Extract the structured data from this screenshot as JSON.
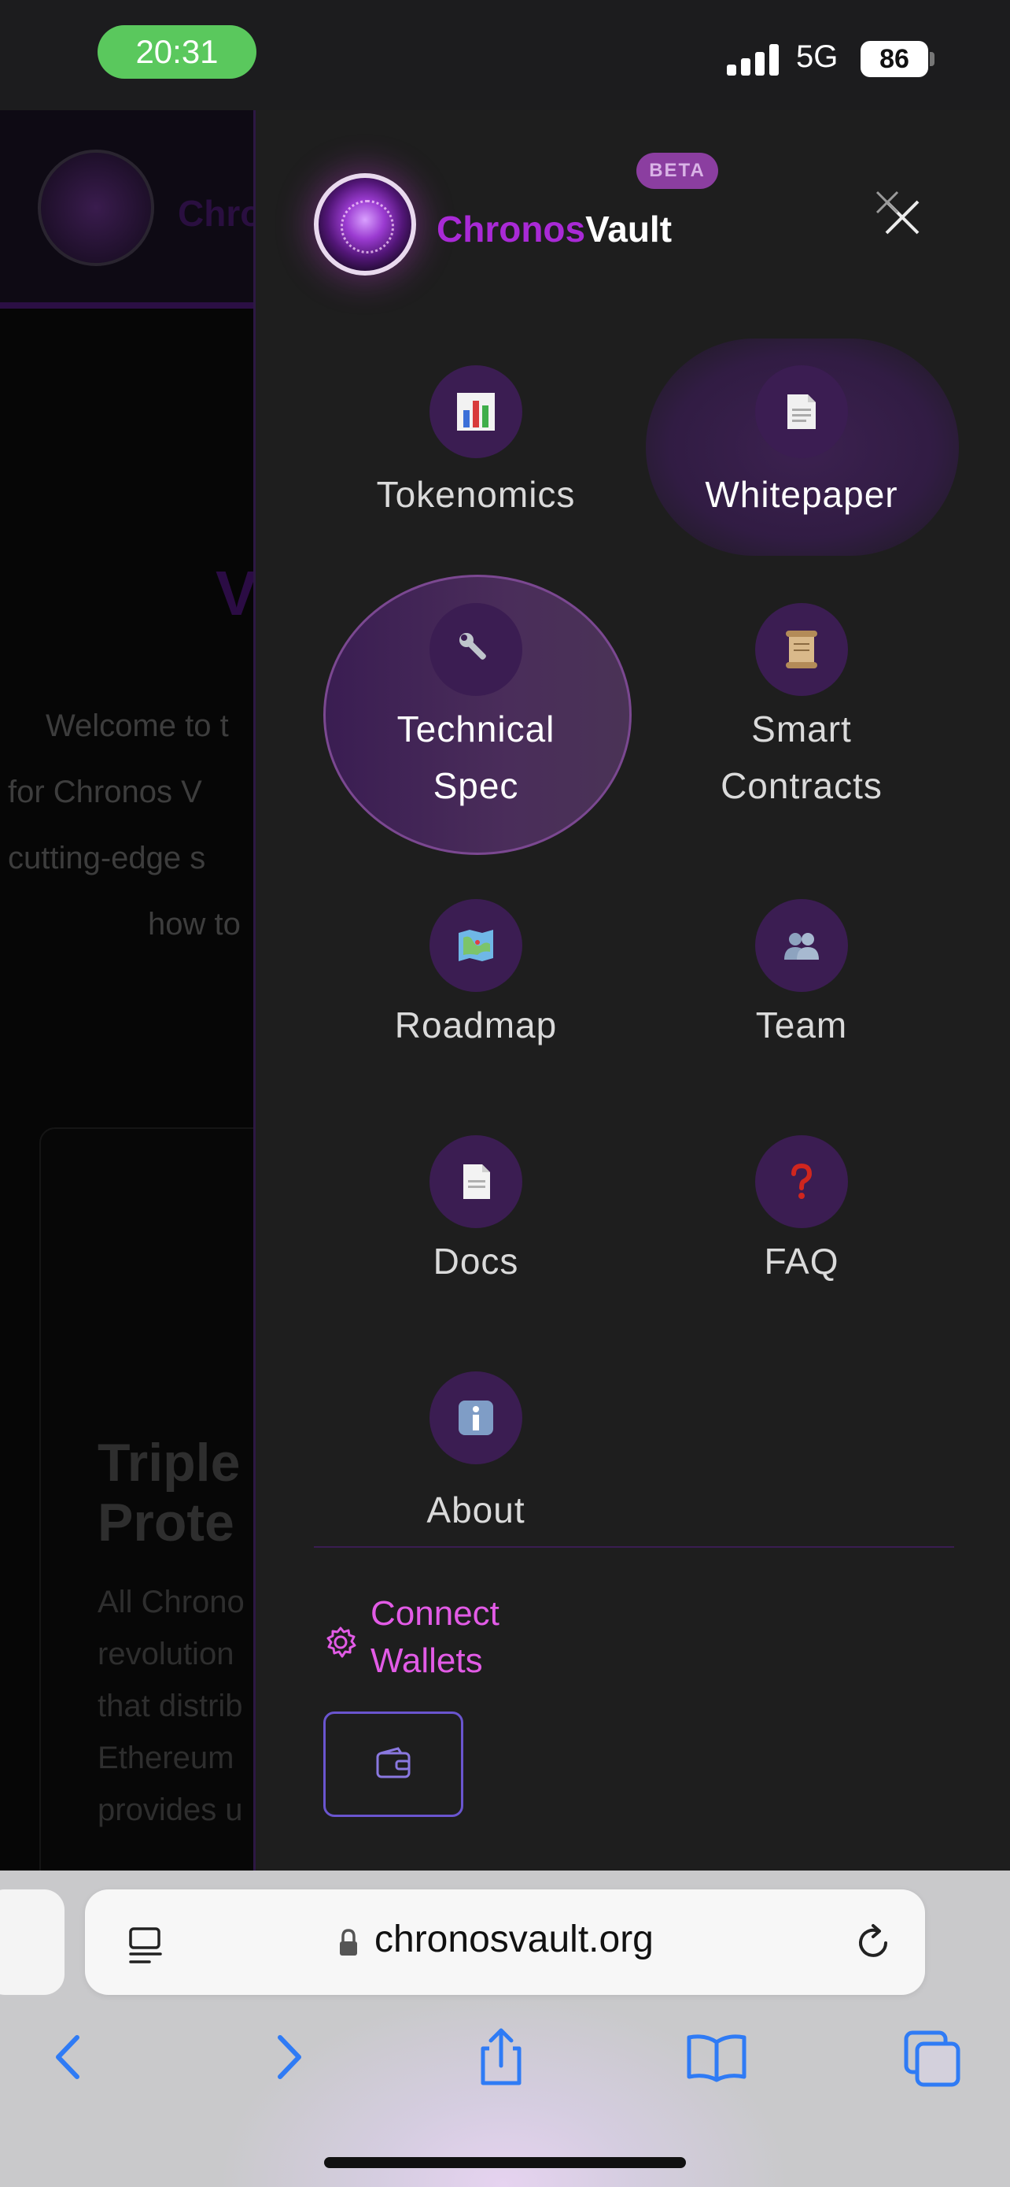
{
  "status_bar": {
    "time": "20:31",
    "network": "5G",
    "battery": "86"
  },
  "background_page": {
    "brand_fragment": "Chro",
    "heading_fragment": "V",
    "welcome_lines": [
      "Welcome to t",
      "for Chronos V",
      "cutting-edge s",
      "how to"
    ],
    "card_title_lines": [
      "Triple",
      "Prote"
    ],
    "card_body_lines": [
      "All Chrono",
      "revolution",
      "that distrib",
      "Ethereum",
      "provides u"
    ]
  },
  "drawer": {
    "brand_first": "Chronos",
    "brand_second": "Vault",
    "beta_badge": "BETA",
    "menu": [
      {
        "label": "Tokenomics",
        "icon": "bar-chart-icon"
      },
      {
        "label": "Whitepaper",
        "icon": "page-icon"
      },
      {
        "label_line1": "Technical",
        "label_line2": "Spec",
        "icon": "wrench-icon"
      },
      {
        "label_line1": "Smart",
        "label_line2": "Contracts",
        "icon": "scroll-icon"
      },
      {
        "label": "Roadmap",
        "icon": "map-icon"
      },
      {
        "label": "Team",
        "icon": "team-icon"
      },
      {
        "label": "Docs",
        "icon": "document-icon"
      },
      {
        "label": "FAQ",
        "icon": "question-icon"
      },
      {
        "label": "About",
        "icon": "info-icon"
      }
    ],
    "connect_line1": "Connect",
    "connect_line2": "Wallets"
  },
  "browser": {
    "url": "chronosvault.org"
  },
  "colors": {
    "accent_purple": "#a92ad6",
    "accent_pink": "#e25be6",
    "drawer_bg": "#1e1e1e",
    "icon_circle": "#3b1d52"
  }
}
